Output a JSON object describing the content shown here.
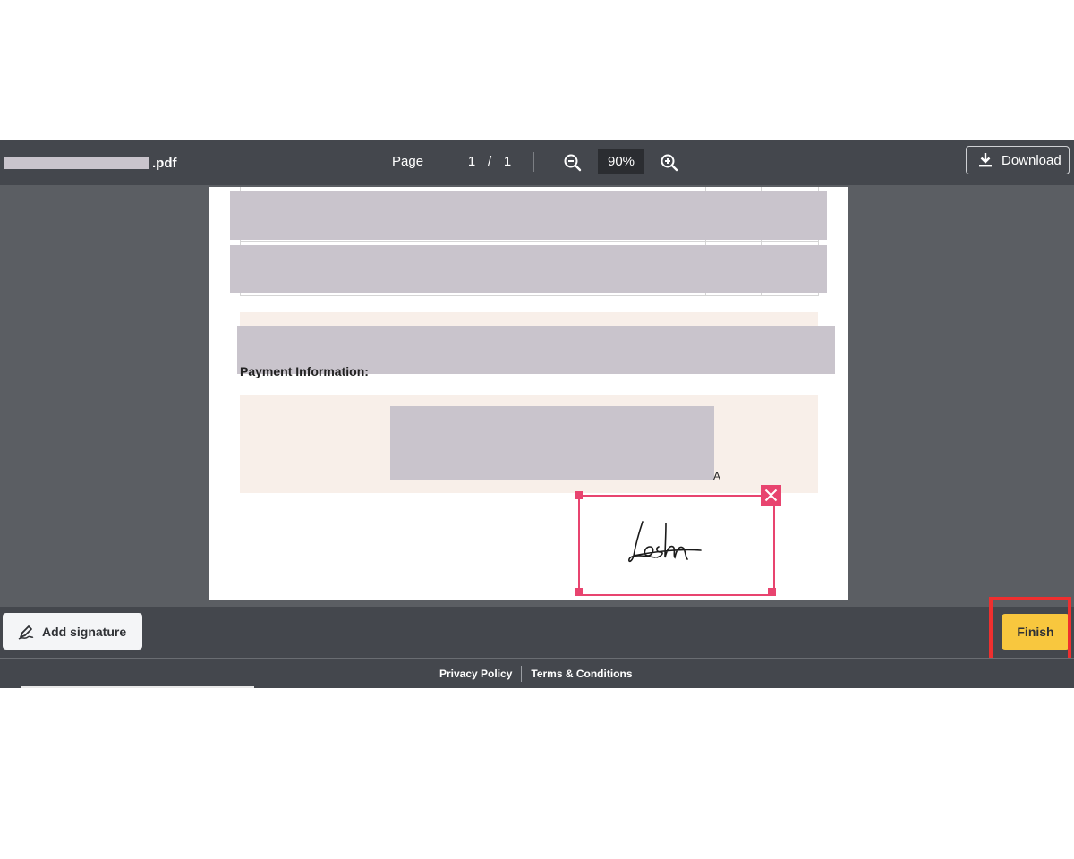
{
  "toolbar": {
    "filename_suffix": ".pdf",
    "page_label": "Page",
    "current_page": "1",
    "page_separator": "/",
    "total_pages": "1",
    "zoom": "90%",
    "download_label": "Download"
  },
  "document": {
    "payment_heading": "Payment Information:",
    "trailing_char": "A"
  },
  "actions": {
    "add_signature_label": "Add signature",
    "finish_label": "Finish"
  },
  "footer": {
    "privacy": "Privacy Policy",
    "terms": "Terms & Conditions"
  },
  "colors": {
    "accent_signature": "#e8446f",
    "finish_button": "#f8c73e",
    "highlight": "#ef2f2f"
  }
}
